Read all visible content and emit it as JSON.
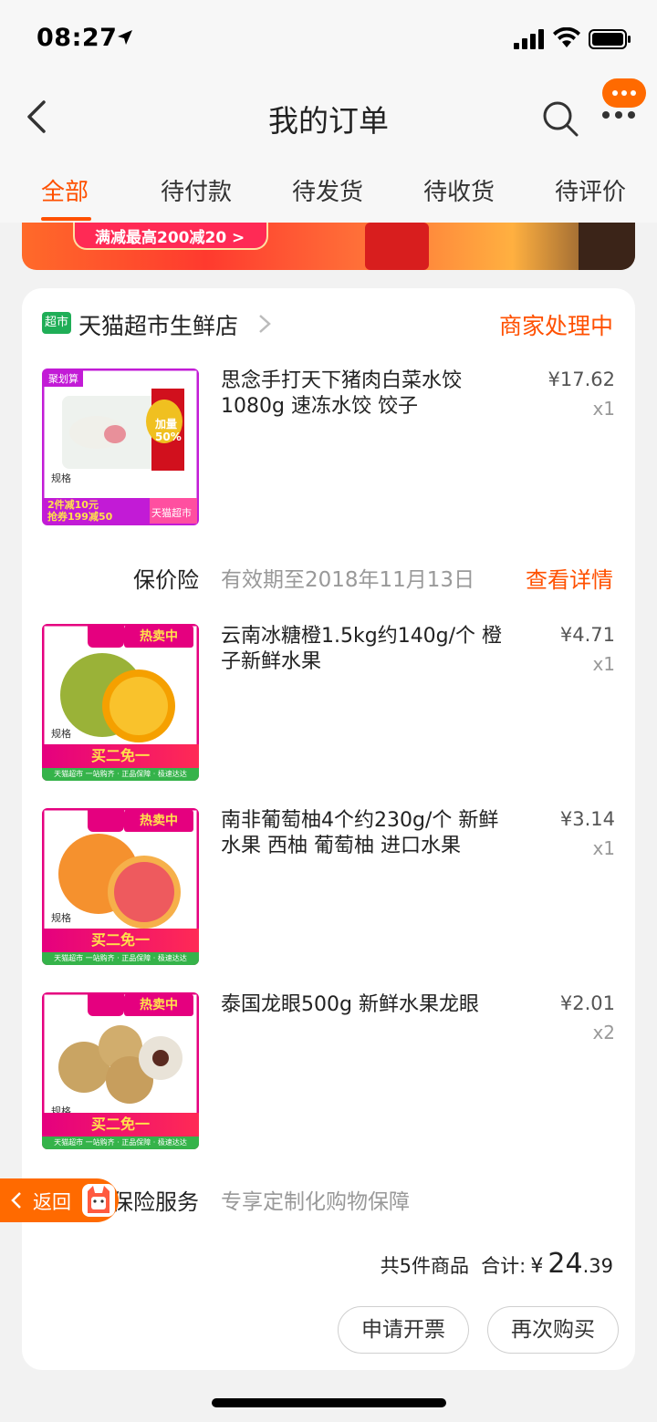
{
  "status_bar": {
    "time": "08:27"
  },
  "nav": {
    "title": "我的订单"
  },
  "tabs": [
    {
      "label": "全部",
      "active": true
    },
    {
      "label": "待付款"
    },
    {
      "label": "待发货"
    },
    {
      "label": "待收货"
    },
    {
      "label": "待评价"
    }
  ],
  "banner": {
    "text": "满减最高200减20 >"
  },
  "order": {
    "store_badge": "超市",
    "store_name": "天猫超市生鲜店",
    "status": "商家处理中",
    "items": [
      {
        "title": "思念手打天下猪肉白菜水饺1080g 速冻水饺 饺子",
        "price": "¥17.62",
        "qty": "x1",
        "thumb": {
          "tag": "聚划算",
          "badge": "加量50%",
          "spec": "规格",
          "strip_top": "2件减10元",
          "strip_bottom": "抢券199减50",
          "corner": "天猫超市"
        }
      },
      {
        "title": "云南冰糖橙1.5kg约140g/个 橙子新鲜水果",
        "price": "¥4.71",
        "qty": "x1",
        "thumb": {
          "tag": "热卖中",
          "spec": "规格",
          "strip": "买二免一",
          "footer": "天猫超市 一站购齐 · 正品保障 · 极速达达"
        }
      },
      {
        "title": "南非葡萄柚4个约230g/个 新鲜水果 西柚 葡萄柚 进口水果",
        "price": "¥3.14",
        "qty": "x1",
        "thumb": {
          "tag": "热卖中",
          "spec": "规格",
          "strip": "买二免一",
          "footer": "天猫超市 一站购齐 · 正品保障 · 极速达达"
        }
      },
      {
        "title": "泰国龙眼500g 新鲜水果龙眼",
        "price": "¥2.01",
        "qty": "x2",
        "thumb": {
          "tag": "热卖中",
          "spec": "规格",
          "strip": "买二免一",
          "footer": "天猫超市 一站购齐 · 正品保障 · 极速达达"
        }
      }
    ],
    "price_protect": {
      "label": "保价险",
      "text": "有效期至2018年11月13日",
      "link": "查看详情"
    },
    "insurance": {
      "label": "保险服务",
      "text": "专享定制化购物保障"
    },
    "summary": {
      "count_text": "共5件商品",
      "total_label": "合计:",
      "currency": "¥",
      "total_int": "24",
      "total_dec": ".39"
    },
    "buttons": {
      "invoice": "申请开票",
      "rebuy": "再次购买"
    }
  },
  "float_back": {
    "label": "返回"
  },
  "colors": {
    "accent": "#ff5000",
    "float": "#ff6a00",
    "green": "#1fae57"
  }
}
